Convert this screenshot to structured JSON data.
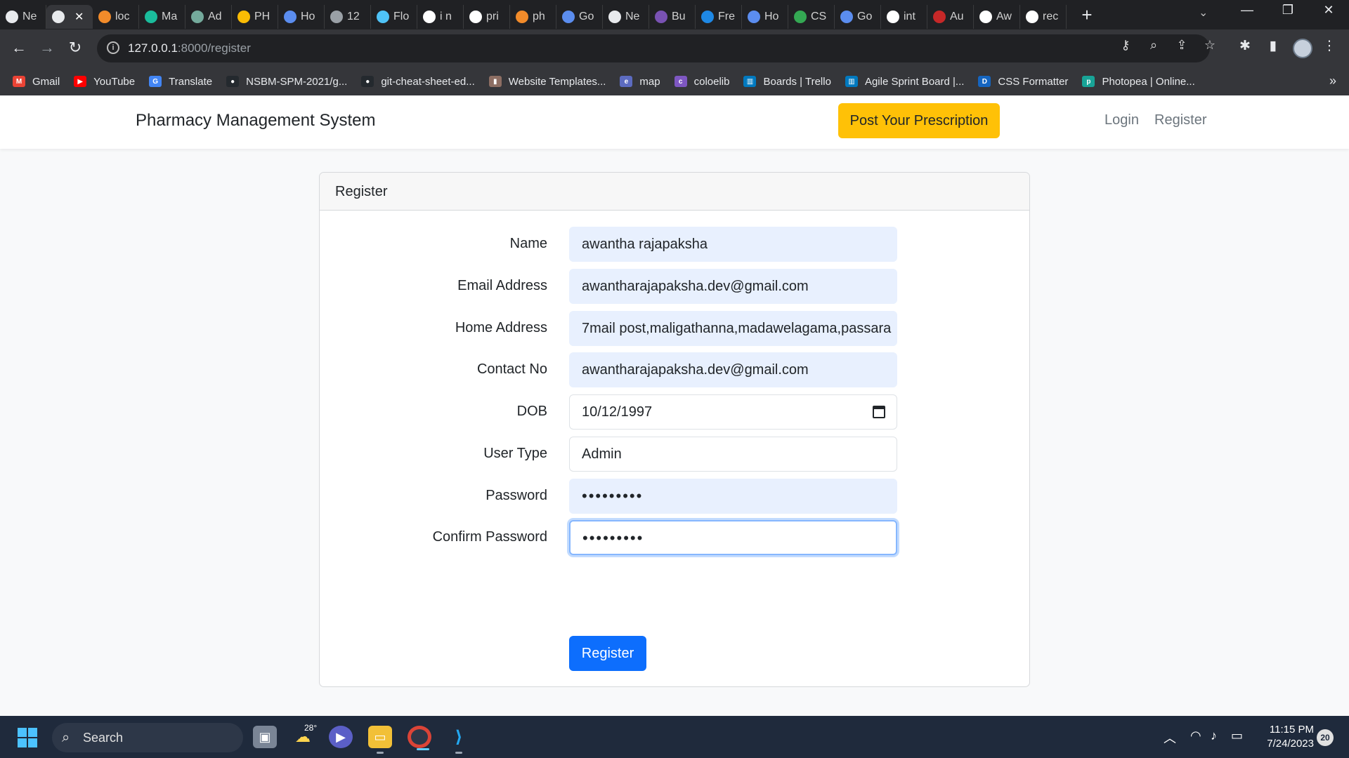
{
  "browser": {
    "tabs": [
      {
        "label": "Ne",
        "icon": "chrome-icon",
        "color": "#e8eaed"
      },
      {
        "label": "",
        "icon": "globe-icon",
        "color": "#e8eaed",
        "active": true
      },
      {
        "label": "loc",
        "icon": "flag-icon",
        "color": "#f28b2a"
      },
      {
        "label": "Ma",
        "icon": "m-icon",
        "color": "#1abc9c"
      },
      {
        "label": "Ad",
        "icon": "openai-icon",
        "color": "#74aa9c"
      },
      {
        "label": "PH",
        "icon": "drive-icon",
        "color": "#fbbc04"
      },
      {
        "label": "Ho",
        "icon": "w3-icon",
        "color": "#5b8def"
      },
      {
        "label": "12",
        "icon": "globe-icon",
        "color": "#9aa0a6"
      },
      {
        "label": "Flo",
        "icon": "search-icon",
        "color": "#4fc3f7"
      },
      {
        "label": "i n",
        "icon": "google-icon",
        "color": "#ffffff"
      },
      {
        "label": "pri",
        "icon": "google-icon",
        "color": "#ffffff"
      },
      {
        "label": "ph",
        "icon": "php-icon",
        "color": "#f28b2a"
      },
      {
        "label": "Go",
        "icon": "translate-icon",
        "color": "#5b8def"
      },
      {
        "label": "Ne",
        "icon": "chrome-icon",
        "color": "#e8eaed"
      },
      {
        "label": "Bu",
        "icon": "bootstrap-icon",
        "color": "#7952b3"
      },
      {
        "label": "Fre",
        "icon": "gear-icon",
        "color": "#1e88e5"
      },
      {
        "label": "Ho",
        "icon": "w3-icon",
        "color": "#5b8def"
      },
      {
        "label": "CS",
        "icon": "w-icon",
        "color": "#34a853"
      },
      {
        "label": "Go",
        "icon": "translate-icon",
        "color": "#5b8def"
      },
      {
        "label": "int",
        "icon": "google-icon",
        "color": "#ffffff"
      },
      {
        "label": "Au",
        "icon": "angular-icon",
        "color": "#c62828"
      },
      {
        "label": "Aw",
        "icon": "github-icon",
        "color": "#ffffff"
      },
      {
        "label": "rec",
        "icon": "google-icon",
        "color": "#ffffff"
      }
    ],
    "new_tab": "+",
    "url_host": "127.0.0.1",
    "url_path": ":8000/register",
    "bookmarks": [
      {
        "label": "Gmail",
        "icon": "gmail-icon",
        "color": "#ea4335",
        "glyph": "M"
      },
      {
        "label": "YouTube",
        "icon": "youtube-icon",
        "color": "#ff0000",
        "glyph": "▶"
      },
      {
        "label": "Translate",
        "icon": "translate-icon",
        "color": "#4285f4",
        "glyph": "G"
      },
      {
        "label": "NSBM-SPM-2021/g...",
        "icon": "github-icon",
        "color": "#24292e",
        "glyph": "●"
      },
      {
        "label": "git-cheat-sheet-ed...",
        "icon": "github-icon",
        "color": "#24292e",
        "glyph": "●"
      },
      {
        "label": "Website Templates...",
        "icon": "template-icon",
        "color": "#8d6e63",
        "glyph": "▮"
      },
      {
        "label": "map",
        "icon": "map-icon",
        "color": "#5c6bc0",
        "glyph": "e"
      },
      {
        "label": "coloelib",
        "icon": "colorlib-icon",
        "color": "#7e57c2",
        "glyph": "c"
      },
      {
        "label": "Boards | Trello",
        "icon": "trello-icon",
        "color": "#0079bf",
        "glyph": "▥"
      },
      {
        "label": "Agile Sprint Board |...",
        "icon": "trello-icon",
        "color": "#0079bf",
        "glyph": "▥"
      },
      {
        "label": "CSS Formatter",
        "icon": "dans-tools-icon",
        "color": "#1565c0",
        "glyph": "D"
      },
      {
        "label": "Photopea | Online...",
        "icon": "photopea-icon",
        "color": "#18a497",
        "glyph": "p"
      }
    ],
    "bookmarks_more": "»"
  },
  "navbar": {
    "brand": "Pharmacy Management System",
    "cta": "Post Your Prescription",
    "login": "Login",
    "register": "Register"
  },
  "form": {
    "header": "Register",
    "fields": [
      {
        "label": "Name",
        "value": "awantha rajapaksha",
        "autofill": true
      },
      {
        "label": "Email Address",
        "value": "awantharajapaksha.dev@gmail.com",
        "autofill": true
      },
      {
        "label": "Home Address",
        "value": "7mail post,maligathanna,madawelagama,passara",
        "autofill": true
      },
      {
        "label": "Contact No",
        "value": "awantharajapaksha.dev@gmail.com",
        "autofill": true
      },
      {
        "label": "DOB",
        "value": "10/12/1997",
        "type": "date"
      },
      {
        "label": "User Type",
        "value": "Admin"
      },
      {
        "label": "Password",
        "value": "•••••••••",
        "autofill": true,
        "password": true
      },
      {
        "label": "Confirm Password",
        "value": "•••••••••",
        "password": true,
        "focused": true
      }
    ],
    "submit": "Register"
  },
  "taskbar": {
    "search_label": "Search",
    "weather_temp": "28°",
    "time": "11:15 PM",
    "date": "7/24/2023",
    "notifications": "20"
  },
  "colors": {
    "primary": "#0d6efd",
    "warning": "#ffc107",
    "autofill": "#e8f0fe"
  }
}
